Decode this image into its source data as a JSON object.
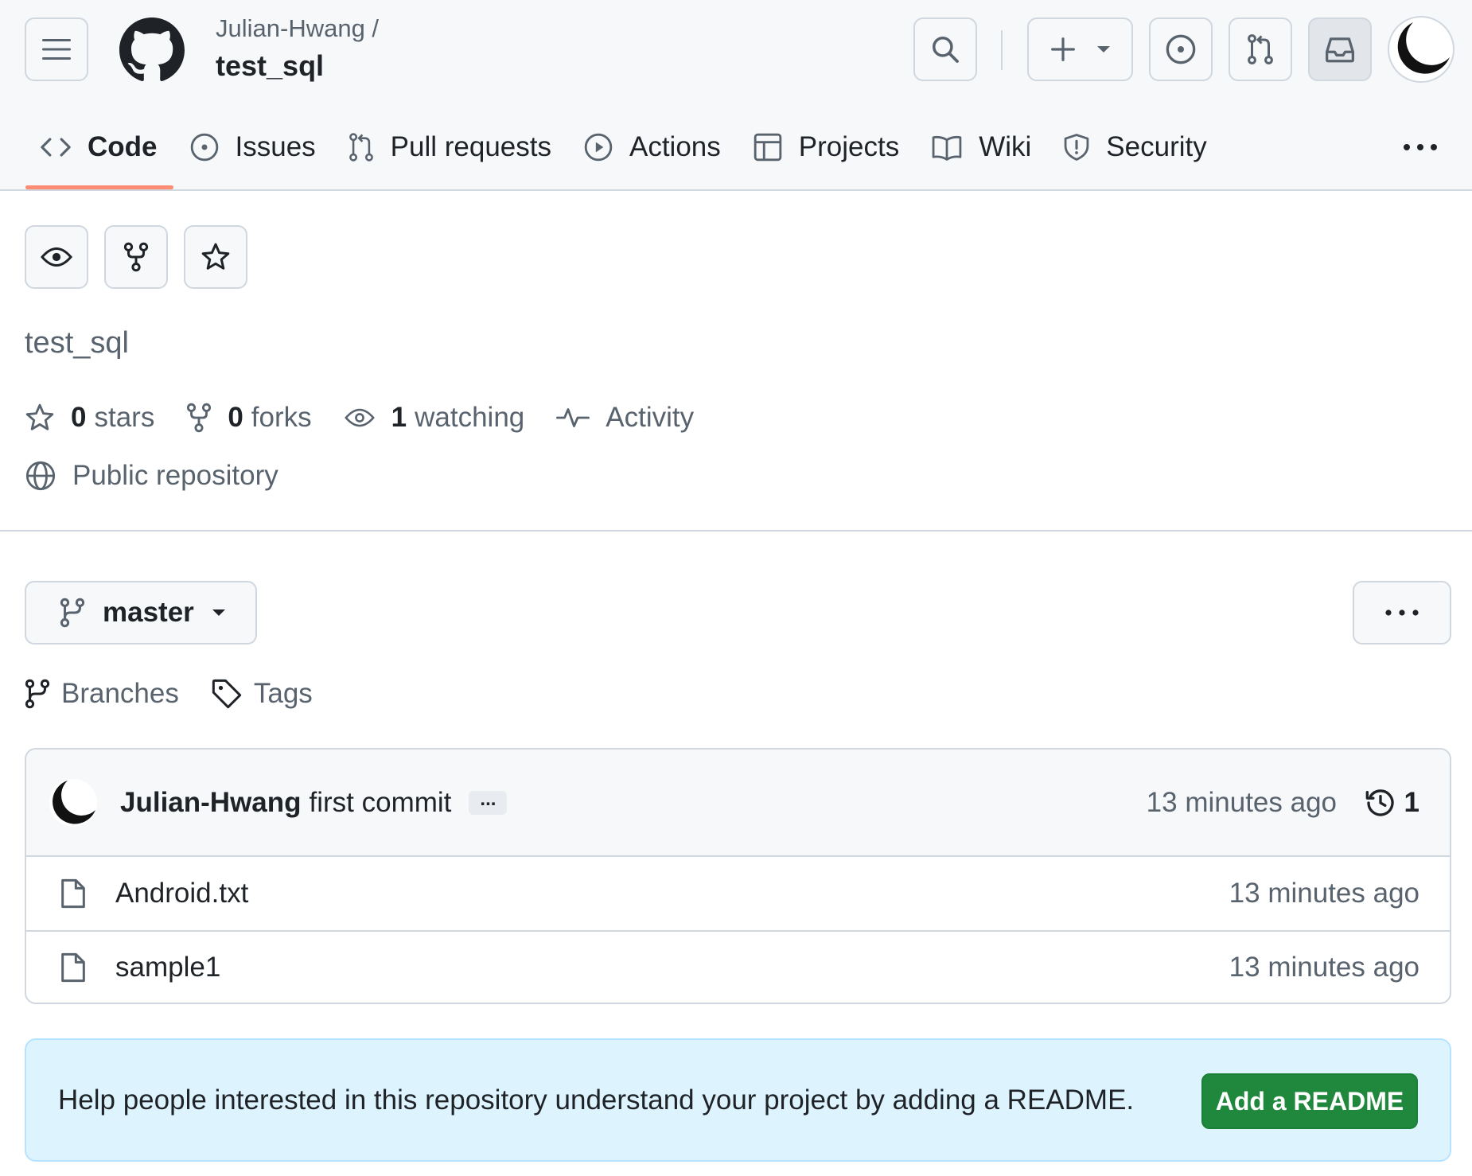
{
  "header": {
    "owner": "Julian-Hwang /",
    "repo": "test_sql"
  },
  "tabs": [
    {
      "label": "Code",
      "icon": "code-icon",
      "active": true
    },
    {
      "label": "Issues",
      "icon": "issue-opened-icon"
    },
    {
      "label": "Pull requests",
      "icon": "git-pull-request-icon"
    },
    {
      "label": "Actions",
      "icon": "play-icon"
    },
    {
      "label": "Projects",
      "icon": "table-icon"
    },
    {
      "label": "Wiki",
      "icon": "book-icon"
    },
    {
      "label": "Security",
      "icon": "shield-icon"
    }
  ],
  "repo": {
    "description": "test_sql",
    "stars_count": "0",
    "stars_label": "stars",
    "forks_count": "0",
    "forks_label": "forks",
    "watching_count": "1",
    "watching_label": "watching",
    "activity_label": "Activity",
    "visibility": "Public repository"
  },
  "branch": {
    "name": "master",
    "branches_label": "Branches",
    "tags_label": "Tags"
  },
  "commit": {
    "author": "Julian-Hwang",
    "message": "first commit",
    "dots": "...",
    "time": "13 minutes ago",
    "count": "1"
  },
  "files": [
    {
      "name": "Android.txt",
      "time": "13 minutes ago"
    },
    {
      "name": "sample1",
      "time": "13 minutes ago"
    }
  ],
  "readme_banner": {
    "text": "Help people interested in this repository understand your project by adding a README.",
    "button": "Add a README"
  },
  "colors": {
    "accent_underline": "#fd8c73",
    "primary_button": "#1f883d",
    "banner_bg": "#ddf4ff"
  }
}
